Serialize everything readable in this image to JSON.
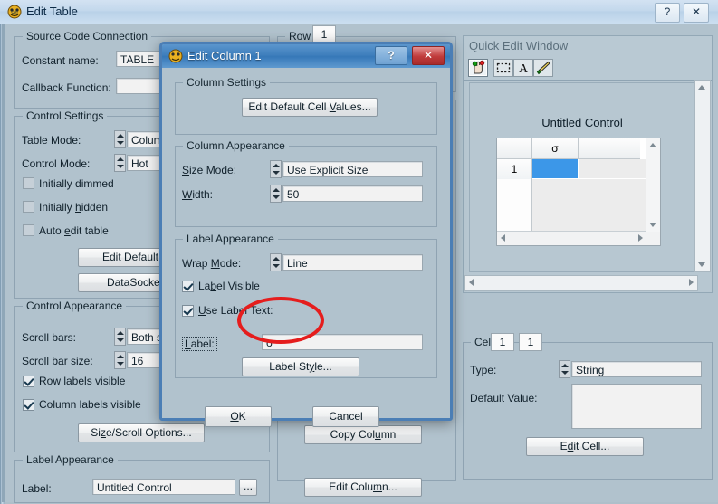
{
  "main_window": {
    "title": "Edit Table",
    "icon": "cvi-app-icon",
    "ghost_text_1": "",
    "ghost_text_2": "",
    "help_glyph": "?",
    "close_glyph": "✕"
  },
  "source_code_connection": {
    "legend": "Source Code Connection",
    "constant_name_label": "Constant name:",
    "constant_name_value": "TABLE",
    "callback_function_label": "Callback Function:",
    "callback_function_value": ""
  },
  "control_settings": {
    "legend": "Control Settings",
    "table_mode_label": "Table Mode:",
    "table_mode_value": "Column",
    "control_mode_label": "Control Mode:",
    "control_mode_value": "Hot",
    "initially_dimmed": "Initially dimmed",
    "initially_hidden": "Initially hidden",
    "auto_edit_table": "Auto edit table",
    "edit_default_cell_button": "Edit Default Cell",
    "datasocket_button": "DataSocket Bi"
  },
  "control_appearance": {
    "legend": "Control Appearance",
    "scroll_bars_label": "Scroll bars:",
    "scroll_bars_value": "Both sc",
    "scroll_bar_size_label": "Scroll bar size:",
    "scroll_bar_size_value": "16",
    "row_labels_visible": "Row labels visible",
    "column_labels_visible": "Column labels visible",
    "size_scroll_options_button": "Size/Scroll Options..."
  },
  "label_appearance_main": {
    "legend": "Label Appearance",
    "label_label": "Label:",
    "label_value": "Untitled Control",
    "browse_button": "..."
  },
  "row_group": {
    "legend": "Row",
    "value": "1"
  },
  "column_buttons": {
    "copy_column": "Copy Column",
    "edit_column": "Edit Column..."
  },
  "quick_edit_window": {
    "title": "Quick Edit Window",
    "tools": [
      {
        "name": "operate-tool-icon",
        "selected": true
      },
      {
        "name": "select-rectangle-tool-icon",
        "selected": false
      },
      {
        "name": "text-tool-icon",
        "selected": false
      },
      {
        "name": "paintbrush-tool-icon",
        "selected": false
      }
    ],
    "canvas_title": "Untitled Control",
    "table": {
      "column_header": "σ",
      "row_header": "1",
      "selected_cell_color": "#3c97e8"
    }
  },
  "cell_group": {
    "legend": "Cell",
    "col_index": "1",
    "row_index": "1",
    "type_label": "Type:",
    "type_value": "String",
    "default_value_label": "Default Value:",
    "default_value": "",
    "edit_cell_button": "Edit Cell..."
  },
  "dialog": {
    "title": "Edit Column 1",
    "icon": "cvi-app-icon",
    "help_glyph": "?",
    "close_glyph": "✕",
    "column_settings": {
      "legend": "Column Settings",
      "edit_default_cell_values_button": "Edit Default Cell Values..."
    },
    "column_appearance": {
      "legend": "Column Appearance",
      "size_mode_label": "Size Mode:",
      "size_mode_value": "Use Explicit Size",
      "width_label": "Width:",
      "width_value": "50"
    },
    "label_appearance": {
      "legend": "Label Appearance",
      "wrap_mode_label": "Wrap Mode:",
      "wrap_mode_value": "Line",
      "label_visible": "Label Visible",
      "use_label_text": "Use Label Text:",
      "label_label": "Label:",
      "label_value": "σ",
      "label_style_button": "Label Style..."
    },
    "ok_button": "OK",
    "cancel_button": "Cancel"
  },
  "annotation": {
    "shape": "ellipse",
    "color": "#e51d1d",
    "targets": "label-text-field"
  }
}
